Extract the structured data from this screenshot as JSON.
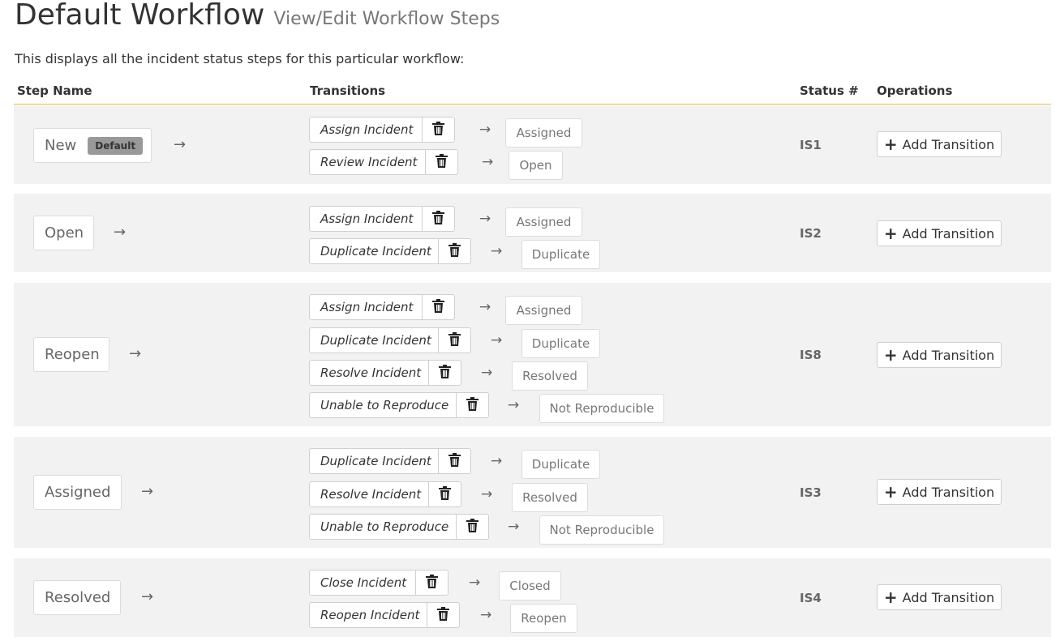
{
  "page": {
    "title": "Default Workflow",
    "subtitle": "View/Edit Workflow Steps",
    "description": "This displays all the incident status steps for this particular workflow:"
  },
  "table": {
    "headers": {
      "step_name": "Step Name",
      "transitions": "Transitions",
      "status_num": "Status #",
      "operations": "Operations"
    },
    "add_transition_label": "Add Transition",
    "arrow_glyph": "→",
    "rows": [
      {
        "step": "New",
        "badge": "Default",
        "status": "IS1",
        "transitions": [
          {
            "name": "Assign Incident",
            "target": "Assigned"
          },
          {
            "name": "Review Incident",
            "target": "Open"
          }
        ]
      },
      {
        "step": "Open",
        "status": "IS2",
        "transitions": [
          {
            "name": "Assign Incident",
            "target": "Assigned"
          },
          {
            "name": "Duplicate Incident",
            "target": "Duplicate"
          }
        ]
      },
      {
        "step": "Reopen",
        "status": "IS8",
        "transitions": [
          {
            "name": "Assign Incident",
            "target": "Assigned"
          },
          {
            "name": "Duplicate Incident",
            "target": "Duplicate"
          },
          {
            "name": "Resolve Incident",
            "target": "Resolved"
          },
          {
            "name": "Unable to Reproduce",
            "target": "Not Reproducible"
          }
        ]
      },
      {
        "step": "Assigned",
        "status": "IS3",
        "transitions": [
          {
            "name": "Duplicate Incident",
            "target": "Duplicate"
          },
          {
            "name": "Resolve Incident",
            "target": "Resolved"
          },
          {
            "name": "Unable to Reproduce",
            "target": "Not Reproducible"
          }
        ]
      },
      {
        "step": "Resolved",
        "status": "IS4",
        "transitions": [
          {
            "name": "Close Incident",
            "target": "Closed"
          },
          {
            "name": "Reopen Incident",
            "target": "Reopen"
          }
        ]
      }
    ]
  },
  "icons": {
    "delete": "trash-icon",
    "add": "plus-icon",
    "arrow": "arrow-right-icon"
  }
}
